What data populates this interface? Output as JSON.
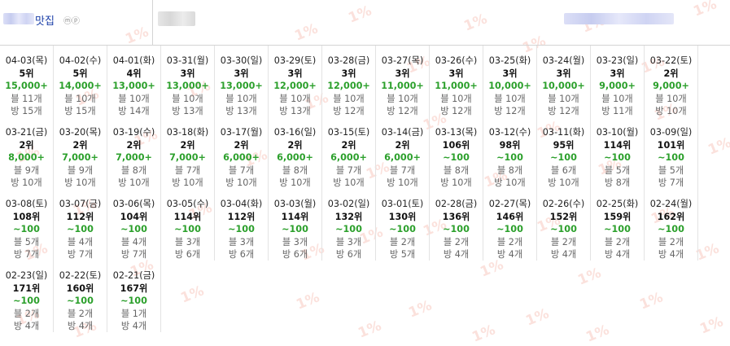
{
  "header": {
    "title_label": "맛집",
    "title_badges": "ⓜⓟ"
  },
  "watermark": {
    "text": "1%"
  },
  "rows": [
    [
      {
        "date": "04-03(목)",
        "rank": "5위",
        "delta": "15,000+",
        "blog": "블 11개",
        "bang": "방 15개"
      },
      {
        "date": "04-02(수)",
        "rank": "5위",
        "delta": "14,000+",
        "blog": "블 10개",
        "bang": "방 15개"
      },
      {
        "date": "04-01(화)",
        "rank": "4위",
        "delta": "13,000+",
        "blog": "블 10개",
        "bang": "방 14개"
      },
      {
        "date": "03-31(월)",
        "rank": "3위",
        "delta": "13,000+",
        "blog": "블 10개",
        "bang": "방 13개"
      },
      {
        "date": "03-30(일)",
        "rank": "3위",
        "delta": "13,000+",
        "blog": "블 10개",
        "bang": "방 13개"
      },
      {
        "date": "03-29(토)",
        "rank": "3위",
        "delta": "12,000+",
        "blog": "블 10개",
        "bang": "방 13개"
      },
      {
        "date": "03-28(금)",
        "rank": "3위",
        "delta": "12,000+",
        "blog": "블 10개",
        "bang": "방 12개"
      },
      {
        "date": "03-27(목)",
        "rank": "3위",
        "delta": "11,000+",
        "blog": "블 10개",
        "bang": "방 12개"
      },
      {
        "date": "03-26(수)",
        "rank": "3위",
        "delta": "11,000+",
        "blog": "블 10개",
        "bang": "방 12개"
      },
      {
        "date": "03-25(화)",
        "rank": "3위",
        "delta": "10,000+",
        "blog": "블 10개",
        "bang": "방 12개"
      },
      {
        "date": "03-24(월)",
        "rank": "3위",
        "delta": "10,000+",
        "blog": "블 10개",
        "bang": "방 12개"
      },
      {
        "date": "03-23(일)",
        "rank": "3위",
        "delta": "9,000+",
        "blog": "블 10개",
        "bang": "방 11개"
      },
      {
        "date": "03-22(토)",
        "rank": "2위",
        "delta": "9,000+",
        "blog": "블 10개",
        "bang": "방 10개"
      }
    ],
    [
      {
        "date": "03-21(금)",
        "rank": "2위",
        "delta": "8,000+",
        "blog": "블 9개",
        "bang": "방 10개"
      },
      {
        "date": "03-20(목)",
        "rank": "2위",
        "delta": "7,000+",
        "blog": "블 9개",
        "bang": "방 10개"
      },
      {
        "date": "03-19(수)",
        "rank": "2위",
        "delta": "7,000+",
        "blog": "블 8개",
        "bang": "방 10개"
      },
      {
        "date": "03-18(화)",
        "rank": "2위",
        "delta": "7,000+",
        "blog": "블 7개",
        "bang": "방 10개"
      },
      {
        "date": "03-17(월)",
        "rank": "2위",
        "delta": "6,000+",
        "blog": "블 7개",
        "bang": "방 10개"
      },
      {
        "date": "03-16(일)",
        "rank": "2위",
        "delta": "6,000+",
        "blog": "블 8개",
        "bang": "방 10개"
      },
      {
        "date": "03-15(토)",
        "rank": "2위",
        "delta": "6,000+",
        "blog": "블 7개",
        "bang": "방 10개"
      },
      {
        "date": "03-14(금)",
        "rank": "2위",
        "delta": "6,000+",
        "blog": "블 7개",
        "bang": "방 10개"
      },
      {
        "date": "03-13(목)",
        "rank": "106위",
        "delta": "~100",
        "blog": "블 8개",
        "bang": "방 10개"
      },
      {
        "date": "03-12(수)",
        "rank": "98위",
        "delta": "~100",
        "blog": "블 8개",
        "bang": "방 10개"
      },
      {
        "date": "03-11(화)",
        "rank": "95위",
        "delta": "~100",
        "blog": "블 6개",
        "bang": "방 10개"
      },
      {
        "date": "03-10(월)",
        "rank": "114위",
        "delta": "~100",
        "blog": "블 5개",
        "bang": "방 8개"
      },
      {
        "date": "03-09(일)",
        "rank": "101위",
        "delta": "~100",
        "blog": "블 5개",
        "bang": "방 7개"
      }
    ],
    [
      {
        "date": "03-08(토)",
        "rank": "108위",
        "delta": "~100",
        "blog": "블 5개",
        "bang": "방 7개"
      },
      {
        "date": "03-07(금)",
        "rank": "112위",
        "delta": "~100",
        "blog": "블 4개",
        "bang": "방 7개"
      },
      {
        "date": "03-06(목)",
        "rank": "104위",
        "delta": "~100",
        "blog": "블 4개",
        "bang": "방 7개"
      },
      {
        "date": "03-05(수)",
        "rank": "114위",
        "delta": "~100",
        "blog": "블 3개",
        "bang": "방 6개"
      },
      {
        "date": "03-04(화)",
        "rank": "112위",
        "delta": "~100",
        "blog": "블 3개",
        "bang": "방 6개"
      },
      {
        "date": "03-03(월)",
        "rank": "114위",
        "delta": "~100",
        "blog": "블 3개",
        "bang": "방 6개"
      },
      {
        "date": "03-02(일)",
        "rank": "132위",
        "delta": "~100",
        "blog": "블 3개",
        "bang": "방 6개"
      },
      {
        "date": "03-01(토)",
        "rank": "130위",
        "delta": "~100",
        "blog": "블 2개",
        "bang": "방 5개"
      },
      {
        "date": "02-28(금)",
        "rank": "136위",
        "delta": "~100",
        "blog": "블 2개",
        "bang": "방 4개"
      },
      {
        "date": "02-27(목)",
        "rank": "146위",
        "delta": "~100",
        "blog": "블 2개",
        "bang": "방 4개"
      },
      {
        "date": "02-26(수)",
        "rank": "152위",
        "delta": "~100",
        "blog": "블 2개",
        "bang": "방 4개"
      },
      {
        "date": "02-25(화)",
        "rank": "159위",
        "delta": "~100",
        "blog": "블 2개",
        "bang": "방 4개"
      },
      {
        "date": "02-24(월)",
        "rank": "162위",
        "delta": "~100",
        "blog": "블 2개",
        "bang": "방 4개"
      }
    ],
    [
      {
        "date": "02-23(일)",
        "rank": "171위",
        "delta": "~100",
        "blog": "블 2개",
        "bang": "방 4개"
      },
      {
        "date": "02-22(토)",
        "rank": "160위",
        "delta": "~100",
        "blog": "블 2개",
        "bang": "방 4개"
      },
      {
        "date": "02-21(금)",
        "rank": "167위",
        "delta": "~100",
        "blog": "블 1개",
        "bang": "방 4개"
      }
    ]
  ]
}
